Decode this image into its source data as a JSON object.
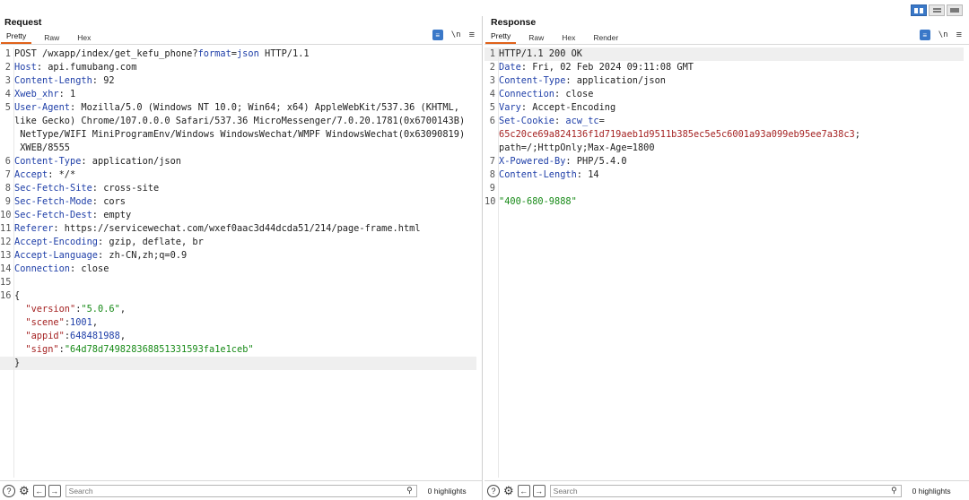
{
  "layout_buttons": [
    "side-by-side",
    "stacked",
    "single"
  ],
  "request": {
    "title": "Request",
    "tabs": [
      {
        "label": "Pretty",
        "active": true
      },
      {
        "label": "Raw",
        "active": false
      },
      {
        "label": "Hex",
        "active": false
      }
    ],
    "tools": {
      "newline_label": "\\n",
      "menu_label": "≡"
    },
    "lines": [
      {
        "n": "1",
        "segments": [
          {
            "t": "POST /wxapp/index/get_kefu_phone?",
            "c": ""
          },
          {
            "t": "format",
            "c": "attr"
          },
          {
            "t": "=",
            "c": ""
          },
          {
            "t": "json",
            "c": "attr"
          },
          {
            "t": " HTTP/1.1",
            "c": ""
          }
        ]
      },
      {
        "n": "2",
        "segments": [
          {
            "t": "Host",
            "c": "k"
          },
          {
            "t": ": api.fumubang.com",
            "c": ""
          }
        ]
      },
      {
        "n": "3",
        "segments": [
          {
            "t": "Content-Length",
            "c": "k"
          },
          {
            "t": ": 92",
            "c": ""
          }
        ]
      },
      {
        "n": "4",
        "segments": [
          {
            "t": "Xweb_xhr",
            "c": "k"
          },
          {
            "t": ": 1",
            "c": ""
          }
        ]
      },
      {
        "n": "5",
        "segments": [
          {
            "t": "User-Agent",
            "c": "k"
          },
          {
            "t": ": Mozilla/5.0 (Windows NT 10.0; Win64; x64) AppleWebKit/537.36 (KHTML,",
            "c": ""
          }
        ]
      },
      {
        "n": "",
        "segments": [
          {
            "t": "like Gecko) Chrome/107.0.0.0 Safari/537.36 MicroMessenger/7.0.20.1781(0x6700143B)",
            "c": ""
          }
        ]
      },
      {
        "n": "",
        "segments": [
          {
            "t": " NetType/WIFI MiniProgramEnv/Windows WindowsWechat/WMPF WindowsWechat(0x63090819)",
            "c": ""
          }
        ]
      },
      {
        "n": "",
        "segments": [
          {
            "t": " XWEB/8555",
            "c": ""
          }
        ]
      },
      {
        "n": "6",
        "segments": [
          {
            "t": "Content-Type",
            "c": "k"
          },
          {
            "t": ": application/json",
            "c": ""
          }
        ]
      },
      {
        "n": "7",
        "segments": [
          {
            "t": "Accept",
            "c": "k"
          },
          {
            "t": ": */*",
            "c": ""
          }
        ]
      },
      {
        "n": "8",
        "segments": [
          {
            "t": "Sec-Fetch-Site",
            "c": "k"
          },
          {
            "t": ": cross-site",
            "c": ""
          }
        ]
      },
      {
        "n": "9",
        "segments": [
          {
            "t": "Sec-Fetch-Mode",
            "c": "k"
          },
          {
            "t": ": cors",
            "c": ""
          }
        ]
      },
      {
        "n": "10",
        "segments": [
          {
            "t": "Sec-Fetch-Dest",
            "c": "k"
          },
          {
            "t": ": empty",
            "c": ""
          }
        ]
      },
      {
        "n": "11",
        "segments": [
          {
            "t": "Referer",
            "c": "k"
          },
          {
            "t": ": https://servicewechat.com/wxef0aac3d44dcda51/214/page-frame.html",
            "c": ""
          }
        ]
      },
      {
        "n": "12",
        "segments": [
          {
            "t": "Accept-Encoding",
            "c": "k"
          },
          {
            "t": ": gzip, deflate, br",
            "c": ""
          }
        ]
      },
      {
        "n": "13",
        "segments": [
          {
            "t": "Accept-Language",
            "c": "k"
          },
          {
            "t": ": zh-CN,zh;q=0.9",
            "c": ""
          }
        ]
      },
      {
        "n": "14",
        "segments": [
          {
            "t": "Connection",
            "c": "k"
          },
          {
            "t": ": close",
            "c": ""
          }
        ]
      },
      {
        "n": "15",
        "segments": [
          {
            "t": "",
            "c": ""
          }
        ]
      },
      {
        "n": "16",
        "segments": [
          {
            "t": "{",
            "c": ""
          }
        ]
      },
      {
        "n": "",
        "segments": [
          {
            "t": "  ",
            "c": ""
          },
          {
            "t": "\"version\"",
            "c": "jkey"
          },
          {
            "t": ":",
            "c": ""
          },
          {
            "t": "\"5.0.6\"",
            "c": "jstr"
          },
          {
            "t": ",",
            "c": ""
          }
        ]
      },
      {
        "n": "",
        "segments": [
          {
            "t": "  ",
            "c": ""
          },
          {
            "t": "\"scene\"",
            "c": "jkey"
          },
          {
            "t": ":",
            "c": ""
          },
          {
            "t": "1001",
            "c": "jnum"
          },
          {
            "t": ",",
            "c": ""
          }
        ]
      },
      {
        "n": "",
        "segments": [
          {
            "t": "  ",
            "c": ""
          },
          {
            "t": "\"appid\"",
            "c": "jkey"
          },
          {
            "t": ":",
            "c": ""
          },
          {
            "t": "648481988",
            "c": "jnum"
          },
          {
            "t": ",",
            "c": ""
          }
        ]
      },
      {
        "n": "",
        "segments": [
          {
            "t": "  ",
            "c": ""
          },
          {
            "t": "\"sign\"",
            "c": "jkey"
          },
          {
            "t": ":",
            "c": ""
          },
          {
            "t": "\"64d78d749828368851331593fa1e1ceb\"",
            "c": "jstr"
          }
        ]
      },
      {
        "n": "",
        "segments": [
          {
            "t": "}",
            "c": ""
          }
        ],
        "highlight": true
      }
    ],
    "search_placeholder": "Search",
    "highlights": "0 highlights"
  },
  "response": {
    "title": "Response",
    "tabs": [
      {
        "label": "Pretty",
        "active": true
      },
      {
        "label": "Raw",
        "active": false
      },
      {
        "label": "Hex",
        "active": false
      },
      {
        "label": "Render",
        "active": false
      }
    ],
    "tools": {
      "newline_label": "\\n",
      "menu_label": "≡"
    },
    "lines": [
      {
        "n": "1",
        "segments": [
          {
            "t": "HTTP/1.1 200 OK",
            "c": ""
          }
        ],
        "highlight": true
      },
      {
        "n": "2",
        "segments": [
          {
            "t": "Date",
            "c": "k"
          },
          {
            "t": ": Fri, 02 Feb 2024 09:11:08 GMT",
            "c": ""
          }
        ]
      },
      {
        "n": "3",
        "segments": [
          {
            "t": "Content-Type",
            "c": "k"
          },
          {
            "t": ": application/json",
            "c": ""
          }
        ]
      },
      {
        "n": "4",
        "segments": [
          {
            "t": "Connection",
            "c": "k"
          },
          {
            "t": ": close",
            "c": ""
          }
        ]
      },
      {
        "n": "5",
        "segments": [
          {
            "t": "Vary",
            "c": "k"
          },
          {
            "t": ": Accept-Encoding",
            "c": ""
          }
        ]
      },
      {
        "n": "6",
        "segments": [
          {
            "t": "Set-Cookie",
            "c": "k"
          },
          {
            "t": ": ",
            "c": ""
          },
          {
            "t": "acw_tc",
            "c": "k"
          },
          {
            "t": "=",
            "c": ""
          }
        ]
      },
      {
        "n": "",
        "segments": [
          {
            "t": "65c20ce69a824136f1d719aeb1d9511b385ec5e5c6001a93a099eb95ee7a38c3",
            "c": "cookie"
          },
          {
            "t": ";",
            "c": ""
          }
        ]
      },
      {
        "n": "",
        "segments": [
          {
            "t": "path=/;HttpOnly;Max-Age=1800",
            "c": ""
          }
        ]
      },
      {
        "n": "7",
        "segments": [
          {
            "t": "X-Powered-By",
            "c": "k"
          },
          {
            "t": ": PHP/5.4.0",
            "c": ""
          }
        ]
      },
      {
        "n": "8",
        "segments": [
          {
            "t": "Content-Length",
            "c": "k"
          },
          {
            "t": ": 14",
            "c": ""
          }
        ]
      },
      {
        "n": "9",
        "segments": [
          {
            "t": "",
            "c": ""
          }
        ]
      },
      {
        "n": "10",
        "segments": [
          {
            "t": "\"400-680-9888\"",
            "c": "jstr"
          }
        ]
      }
    ],
    "search_placeholder": "Search",
    "highlights": "0 highlights"
  },
  "statusbar": {
    "help_icon": "?",
    "back_arrow": "←",
    "forward_arrow": "→",
    "search_glyph": "⚲"
  }
}
